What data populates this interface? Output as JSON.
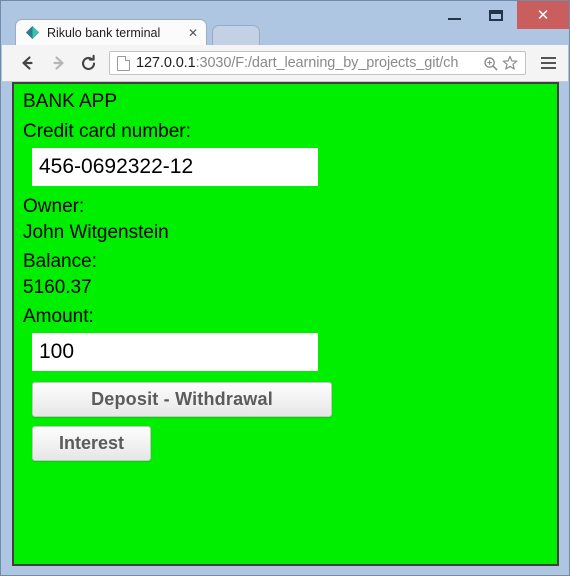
{
  "window": {
    "controls": {
      "minimize_label": "–",
      "maximize_label": "",
      "close_label": "✕"
    }
  },
  "browser": {
    "tab": {
      "title": "Rikulo bank terminal",
      "close_label": "✕",
      "favicon": "rikulo-diamond-icon"
    },
    "new_tab_label": "",
    "nav": {
      "back_label": "←",
      "forward_label": "→",
      "reload_label": "↻"
    },
    "omnibox": {
      "host": "127.0.0.1",
      "path": ":3030/F:/dart_learning_by_projects_git/ch",
      "zoom_icon": "magnifier-icon",
      "bookmark_icon": "star-icon"
    },
    "menu_label": "≡"
  },
  "page": {
    "background_color": "#00ee00",
    "app_title": "BANK APP",
    "labels": {
      "credit_card": "Credit card number:",
      "owner": "Owner:",
      "balance": "Balance:",
      "amount": "Amount:"
    },
    "values": {
      "credit_card_number": "456-0692322-12",
      "owner_name": "John Witgenstein",
      "balance": "5160.37",
      "amount": "100"
    },
    "buttons": {
      "deposit_withdrawal": "Deposit - Withdrawal",
      "interest": "Interest"
    }
  }
}
